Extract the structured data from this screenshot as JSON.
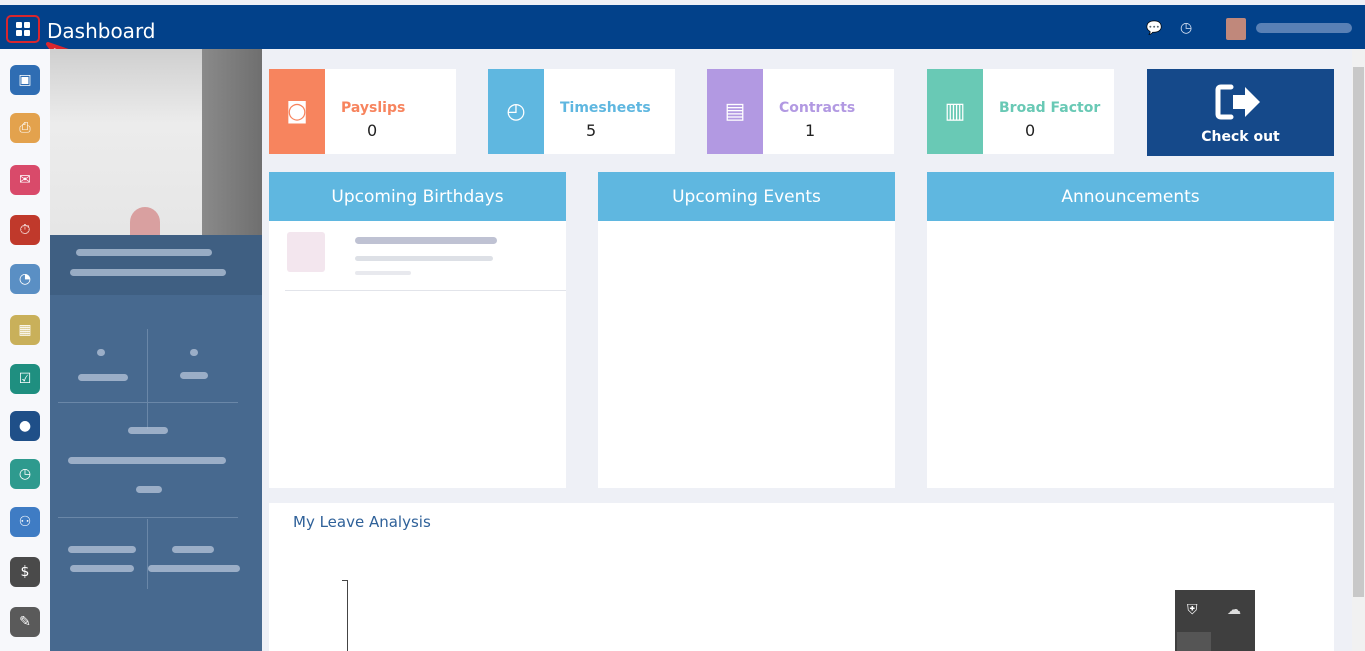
{
  "header": {
    "title": "Dashboard",
    "icons": [
      "grid-icon",
      "chat-icon",
      "clock-icon"
    ],
    "brand_color": "#02418a"
  },
  "sidebar_icons": [
    {
      "name": "monitor-icon",
      "color": "#2f6db3",
      "glyph": "▣"
    },
    {
      "name": "printer-icon",
      "color": "#e3a24d",
      "glyph": "⎙"
    },
    {
      "name": "comment-icon",
      "color": "#d94a6a",
      "glyph": "✉"
    },
    {
      "name": "timer-icon",
      "color": "#c0392b",
      "glyph": "⏱"
    },
    {
      "name": "user-clock-icon",
      "color": "#5a8fc4",
      "glyph": "◔"
    },
    {
      "name": "calendar-icon",
      "color": "#c9b05a",
      "glyph": "▦"
    },
    {
      "name": "checklist-icon",
      "color": "#1f8f80",
      "glyph": "☑"
    },
    {
      "name": "badge-icon",
      "color": "#1f4f88",
      "glyph": "●"
    },
    {
      "name": "clock-circle-icon",
      "color": "#2e9a8e",
      "glyph": "◷"
    },
    {
      "name": "handshake-icon",
      "color": "#3f7cc4",
      "glyph": "⚇"
    },
    {
      "name": "user-dollar-icon",
      "color": "#4a4a4a",
      "glyph": "$"
    },
    {
      "name": "notes-icon",
      "color": "#5a5a5a",
      "glyph": "✎"
    }
  ],
  "stats": [
    {
      "label": "Payslips",
      "value": "0",
      "color": "#f7845e",
      "icon": "money-icon",
      "glyph": "◙"
    },
    {
      "label": "Timesheets",
      "value": "5",
      "color": "#5fb7e0",
      "icon": "clock-icon",
      "glyph": "◴"
    },
    {
      "label": "Contracts",
      "value": "1",
      "color": "#b299e2",
      "icon": "file-icon",
      "glyph": "▤"
    },
    {
      "label": "Broad Factor",
      "value": "0",
      "color": "#69c9b5",
      "icon": "bar-chart-icon",
      "glyph": "▥"
    }
  ],
  "checkout": {
    "label": "Check out",
    "icon": "sign-out-icon"
  },
  "panels": {
    "birthdays": {
      "title": "Upcoming Birthdays"
    },
    "events": {
      "title": "Upcoming Events"
    },
    "announcements": {
      "title": "Announcements"
    }
  },
  "leave": {
    "title": "My Leave Analysis"
  }
}
